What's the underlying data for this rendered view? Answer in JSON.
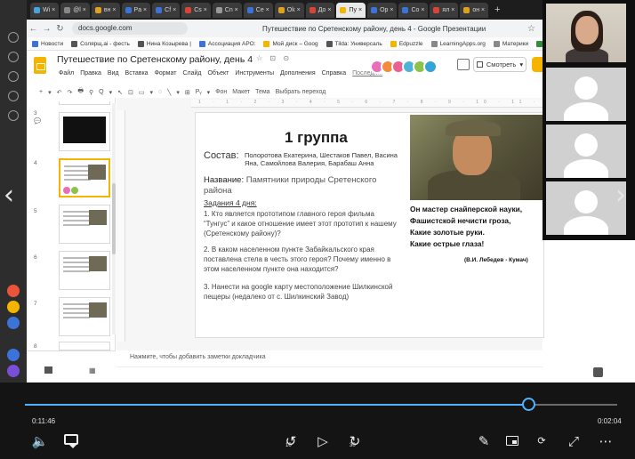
{
  "browser": {
    "tabs": [
      {
        "label": "Wi ×",
        "color": "#4aa3df",
        "active": false
      },
      {
        "label": "@l ×",
        "color": "#888888",
        "active": false
      },
      {
        "label": "вн ×",
        "color": "#e0a020",
        "active": false
      },
      {
        "label": "Pa ×",
        "color": "#3b73d9",
        "active": false
      },
      {
        "label": "Cf ×",
        "color": "#3b73d9",
        "active": false
      },
      {
        "label": "Cs ×",
        "color": "#d94437",
        "active": false
      },
      {
        "label": "Cn ×",
        "color": "#999999",
        "active": false
      },
      {
        "label": "Ce ×",
        "color": "#3b73d9",
        "active": false
      },
      {
        "label": "Ok ×",
        "color": "#e0a020",
        "active": false
      },
      {
        "label": "До ×",
        "color": "#d94437",
        "active": false
      },
      {
        "label": "Пу ×",
        "color": "#f4b400",
        "active": true
      },
      {
        "label": "Op ×",
        "color": "#3b73d9",
        "active": false
      },
      {
        "label": "Co ×",
        "color": "#3b73d9",
        "active": false
      },
      {
        "label": "ял ×",
        "color": "#d94437",
        "active": false
      },
      {
        "label": "он ×",
        "color": "#e0a020",
        "active": false
      }
    ],
    "new_tab": "+",
    "url": "docs.google.com",
    "page_title": "Путешествие по Сретенскому району, день 4 - Google Презентации",
    "bookmarks": [
      {
        "label": "Новости",
        "color": "#3b73d9"
      },
      {
        "label": "Солярщ.ai - фесть",
        "color": "#555555"
      },
      {
        "label": "Нина Козырева |",
        "color": "#555555"
      },
      {
        "label": "Ассоциация АРО:",
        "color": "#3b73d9"
      },
      {
        "label": "Мой диск – Goog",
        "color": "#f4b400"
      },
      {
        "label": "Tilda: Универсаль",
        "color": "#555555"
      },
      {
        "label": "Edpuzzle",
        "color": "#f4b400"
      },
      {
        "label": "LearningApps.org",
        "color": "#888888"
      },
      {
        "label": "Материки",
        "color": "#888888"
      },
      {
        "label": "Lear",
        "color": "#2f8f3a"
      }
    ]
  },
  "slides": {
    "title": "Путешествие по Сретенскому району, день 4",
    "title_icons": "☆ ⊡ ⊙",
    "menu": [
      "Файл",
      "Правка",
      "Вид",
      "Вставка",
      "Формат",
      "Слайд",
      "Объект",
      "Инструменты",
      "Дополнения",
      "Справка"
    ],
    "last_edit": "Последн...",
    "view_button": "Смотреть",
    "collaborator_colors": [
      "#e96eb8",
      "#f48a3c",
      "#ec5f93",
      "#4fb3d9",
      "#8ac24a",
      "#34a3d6"
    ],
    "toolbar": {
      "items": [
        "+",
        "▾",
        "↶",
        "↷",
        "🖶",
        "⚲",
        "Q",
        "▾",
        "↖",
        "⊡",
        "▭",
        "▾",
        "◌",
        "╲",
        "▾",
        "⊞",
        "Pᵧ",
        "▾"
      ],
      "background": "Фон",
      "layout": "Макет",
      "theme": "Тема",
      "transition": "Выбрать переход"
    },
    "ruler_marks": "1 · 1 · 2 · 3 · 4 · 5 · 6 · 7 · 8 · 9 · 10 · 11 · 12 · 13 · 14 · 15 · 16 · 17 · 18 · 19 · 20 · 21 · 22 · 23 · 24 · 25",
    "thumb_numbers": [
      "3",
      "4",
      "5",
      "6",
      "7",
      "8"
    ],
    "notes_placeholder": "Нажмите, чтобы добавить заметки докладчика"
  },
  "slide": {
    "group_title": "1 группа",
    "composition_label": "Состав:",
    "composition": "Полоротова Екатерина, Шестаков Павел, Васина Яна, Самойлова Валерия, Барабаш Анна",
    "topic_label": "Название:",
    "topic": "Памятники природы Сретенского района",
    "tasks_heading": "Задания 4 дня:",
    "task1": "1. Кто является прототипом главного героя фильма “Тунгус” и какое отношение имеет этот прототип к нашему (Сретенскому району)?",
    "task2": "2. В каком населенном пункте Забайкальского края поставлена стела в честь этого героя? Почему именно в этом населенном пункте она находится?",
    "task3": "3. Нанести на google карту местоположение Шилкинской пещеры  (недалеко от с. Шилкинский Завод)",
    "poem": [
      "Он мастер снайперской науки,",
      "Фашистской нечисти гроза,",
      "Какие золотые руки.",
      "Какие острые глаза!"
    ],
    "poem_author": "(В.И. Лебедев - Кумач)"
  },
  "player": {
    "time_current": "0:11:46",
    "time_remaining": "0:02:04",
    "progress_percent": 85.0,
    "skip_back_label": "10",
    "skip_forward_label": "30",
    "accent_color": "#4fb3ff"
  }
}
